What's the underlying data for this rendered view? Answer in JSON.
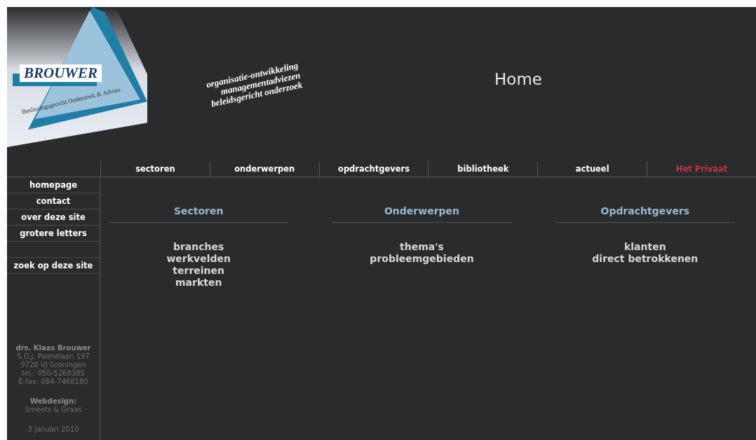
{
  "logo": {
    "name": "BROUWER",
    "subtitle": "Beslissingsgericht Onderzoek & Advies"
  },
  "tagline": [
    "organisatie-ontwikkeling",
    "managementadviezen",
    "beleidsgericht onderzoek"
  ],
  "page_title": "Home",
  "nav": [
    {
      "label": "sectoren",
      "color": "#ffffff"
    },
    {
      "label": "onderwerpen",
      "color": "#ffffff"
    },
    {
      "label": "opdrachtgevers",
      "color": "#ffffff"
    },
    {
      "label": "bibliotheek",
      "color": "#ffffff"
    },
    {
      "label": "actueel",
      "color": "#ffffff"
    },
    {
      "label": "Het Privaat",
      "color": "#c8323c"
    }
  ],
  "sidebar": {
    "items": [
      {
        "kind": "link",
        "label": "homepage"
      },
      {
        "kind": "link",
        "label": "contact"
      },
      {
        "kind": "link",
        "label": "over deze site"
      },
      {
        "kind": "link",
        "label": "grotere letters"
      },
      {
        "kind": "blank"
      },
      {
        "kind": "link",
        "label": "zoek op deze site"
      }
    ],
    "contact": {
      "name": "drs. Klaas Brouwer",
      "lines": [
        "S.O.J. Palmelaan 197",
        "9728 VJ Groningen",
        "tel.: 050-5268385",
        "E-fax: 084-7468180"
      ]
    },
    "credit": {
      "heading": "Webdesign:",
      "text": "Smeets & Graas"
    },
    "date": "3 januari 2010"
  },
  "columns": [
    {
      "heading": "Sectoren",
      "links": [
        "branches",
        "werkvelden",
        "terreinen",
        "markten"
      ]
    },
    {
      "heading": "Onderwerpen",
      "links": [
        "thema's",
        "probleemgebieden"
      ]
    },
    {
      "heading": "Opdrachtgevers",
      "links": [
        "klanten",
        "direct betrokkenen"
      ]
    }
  ]
}
